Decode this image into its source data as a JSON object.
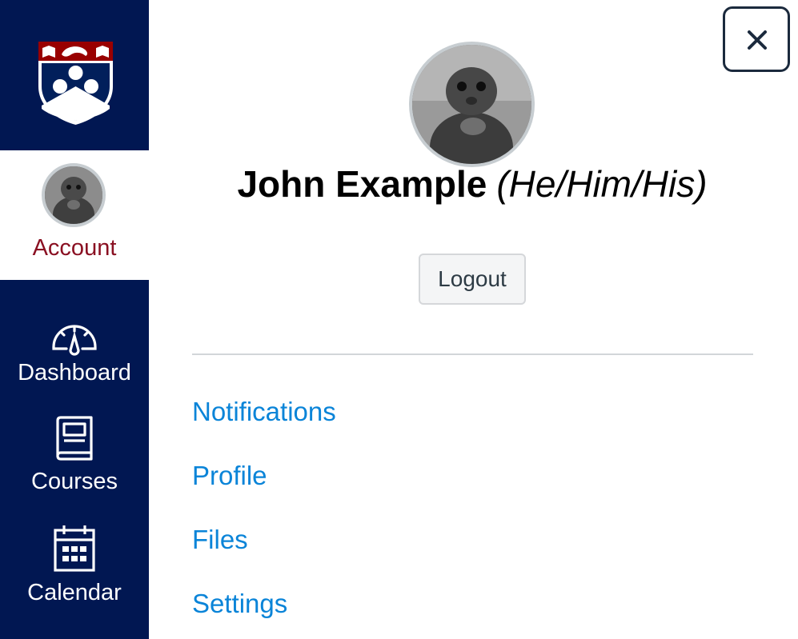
{
  "colors": {
    "nav_background": "#011752",
    "account_label": "#8a1022",
    "link": "#0a84d8",
    "shield_crimson": "#990000",
    "shield_blue": "#011f5b"
  },
  "nav": {
    "logo_icon": "penn-shield-logo",
    "account": {
      "label": "Account",
      "icon": "user-avatar"
    },
    "items": [
      {
        "label": "Dashboard",
        "icon": "dashboard-gauge-icon"
      },
      {
        "label": "Courses",
        "icon": "book-icon"
      },
      {
        "label": "Calendar",
        "icon": "calendar-icon"
      }
    ]
  },
  "tray": {
    "close_icon": "close-icon",
    "user": {
      "name": "John Example",
      "pronouns": "(He/Him/His)"
    },
    "logout_label": "Logout",
    "links": [
      {
        "label": "Notifications"
      },
      {
        "label": "Profile"
      },
      {
        "label": "Files"
      },
      {
        "label": "Settings"
      }
    ]
  }
}
